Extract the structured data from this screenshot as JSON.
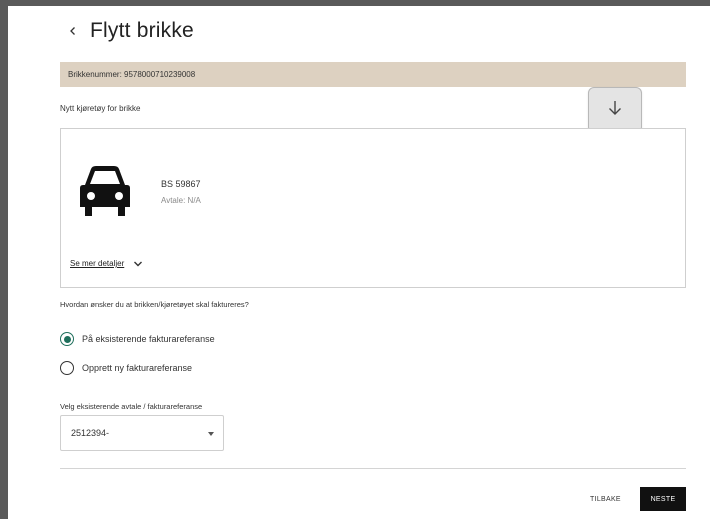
{
  "page": {
    "title": "Flytt brikke"
  },
  "tag": {
    "label": "Brikkenummer: 9578000710239008"
  },
  "vehicle": {
    "section_label": "Nytt kjøretøy for brikke",
    "plate": "BS 59867",
    "agreement": "Avtale: N/A",
    "details_link": "Se mer detaljer"
  },
  "billing": {
    "question": "Hvordan ønsker du at brikken/kjøretøyet skal faktureres?",
    "options": [
      {
        "label": "På eksisterende fakturareferanse",
        "checked": true
      },
      {
        "label": "Opprett ny fakturareferanse",
        "checked": false
      }
    ],
    "select_label": "Velg eksisterende avtale / fakturareferanse",
    "select_value": "2512394-"
  },
  "footer": {
    "back_label": "TILBAKE",
    "next_label": "NESTE"
  },
  "colors": {
    "tag_bar": "#ddd1c1",
    "radio_accent": "#1f6f5c",
    "primary_button": "#111111"
  },
  "icons": {
    "back": "chevron-left-icon",
    "download": "arrow-down-icon",
    "vehicle": "car-icon",
    "details": "chevron-down-icon",
    "select": "caret-down-icon"
  }
}
